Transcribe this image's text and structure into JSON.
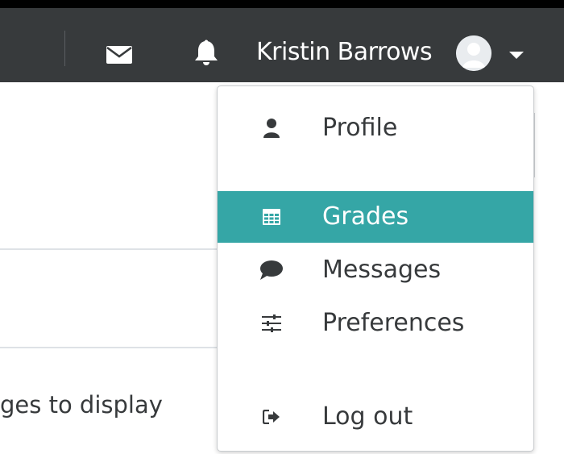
{
  "header": {
    "user_name": "Kristin Barrows",
    "icons": {
      "messages": "envelope-icon",
      "notifications": "bell-icon",
      "avatar": "user-avatar",
      "menu_toggle": "caret-down-icon"
    }
  },
  "user_menu": {
    "items": [
      {
        "label": "Profile",
        "icon": "user-icon",
        "active": false
      },
      {
        "label": "Grades",
        "icon": "table-icon",
        "active": true
      },
      {
        "label": "Messages",
        "icon": "comment-icon",
        "active": false
      },
      {
        "label": "Preferences",
        "icon": "sliders-icon",
        "active": false
      },
      {
        "label": "Log out",
        "icon": "sign-out-icon",
        "active": false
      }
    ],
    "active_color": "#35a6a6"
  },
  "background_page": {
    "partial_text": "ges to display"
  },
  "colors": {
    "navbar": "#373a3c",
    "text": "#373a3c",
    "accent": "#35a6a6"
  }
}
